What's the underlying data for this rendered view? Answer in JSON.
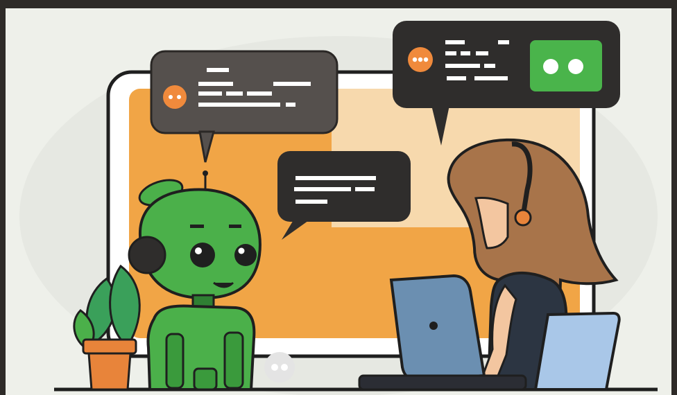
{
  "scene": {
    "description_free": true,
    "colors": {
      "background": "#eef0ea",
      "frame": "#2e2b28",
      "screen_orange": "#f1a546",
      "screen_light": "#f7d9ad",
      "bubble_dark": "#2f2d2c",
      "bubble_gray": "#55504d",
      "robot_green": "#4bb04a",
      "robot_dark_green": "#2f7f33",
      "hair": "#a8744a",
      "skin": "#f3c6a0",
      "shirt": "#2c3542",
      "laptop_blue": "#6b8fb1",
      "chair_blue": "#a9c7e8",
      "pot": "#e8843a",
      "accent_green_button": "#4ab44b",
      "dot_orange": "#f08a3c"
    },
    "icons": [
      "chat-bubble-icon",
      "robot-icon",
      "woman-with-headset-icon",
      "laptop-icon",
      "plant-icon",
      "typing-dots-icon"
    ]
  }
}
